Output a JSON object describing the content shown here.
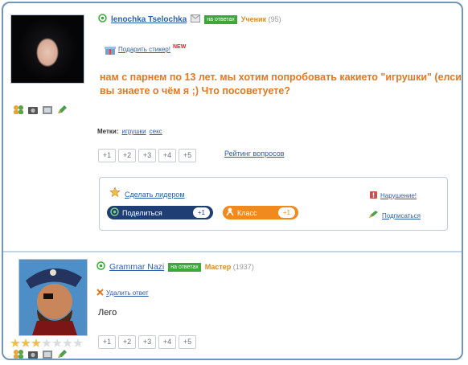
{
  "post": {
    "author": "lenochka Tselochka",
    "badge": "на ответах",
    "rank": "Ученик",
    "points": "(95)",
    "gift_link": "Подарить стикер!",
    "new_label": "NEW",
    "question": "нам с парнем по 13 лет. мы хотим попробовать какието \"игрушки\" (елси вы знаете о чём я ;) Что посоветуете?",
    "tags_label": "Метки:",
    "tags": [
      "игрушки",
      "секс"
    ],
    "votes": [
      "+1",
      "+2",
      "+3",
      "+4",
      "+5"
    ],
    "rating_link": "Рейтинг вопросов",
    "make_leader": "Сделать лидером",
    "report": "Нарушение!",
    "share_label": "Поделиться",
    "share_count": "+1",
    "class_label": "Класс",
    "class_count": "+1",
    "subscribe": "Подписаться"
  },
  "answer": {
    "author": "Grammar Nazi",
    "badge": "на ответах",
    "rank": "Мастер",
    "points": "(1937)",
    "delete_link": "Удалить ответ",
    "text": "Лего",
    "votes": [
      "+1",
      "+2",
      "+3",
      "+4",
      "+5"
    ]
  },
  "colors": {
    "accent_link": "#2a5fa8",
    "question_orange": "#e27820",
    "badge_green": "#3aa93a",
    "share_blue": "#1f3e73",
    "class_orange": "#f08a1e"
  }
}
